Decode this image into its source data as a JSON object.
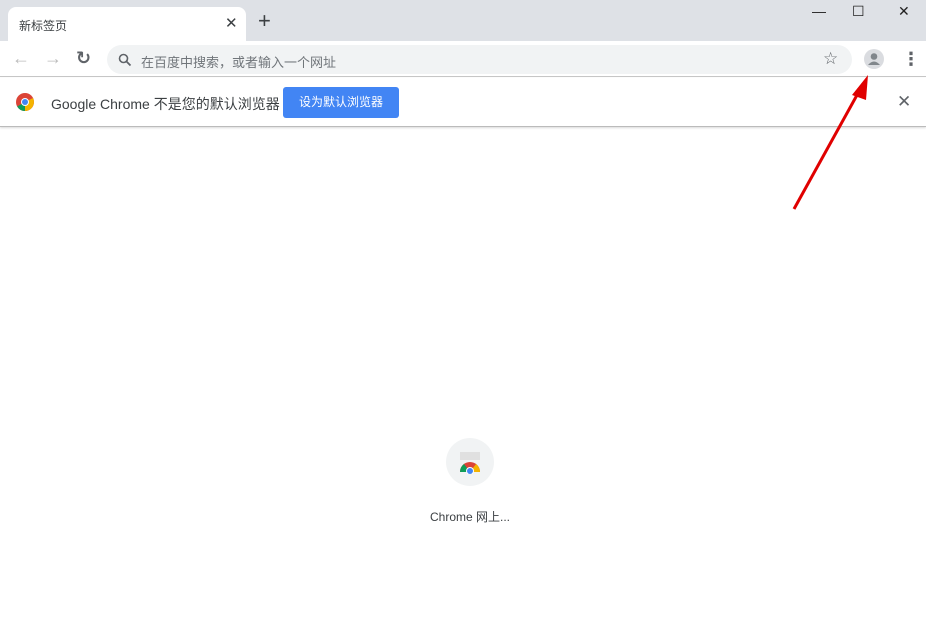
{
  "tab": {
    "title": "新标签页",
    "close": "✕"
  },
  "newtab": "+",
  "window": {
    "minimize": "—",
    "maximize": "☐",
    "close": "✕"
  },
  "toolbar": {
    "back": "←",
    "forward": "→",
    "reload": "↻",
    "placeholder": "在百度中搜索，或者输入一个网址",
    "star": "☆",
    "menu": "⋮"
  },
  "infobar": {
    "message": "Google Chrome 不是您的默认浏览器",
    "button": "设为默认浏览器",
    "close": "✕"
  },
  "shortcut": {
    "label": "Chrome 网上..."
  },
  "colors": {
    "accent": "#4285f4",
    "annotation": "#e00000"
  }
}
